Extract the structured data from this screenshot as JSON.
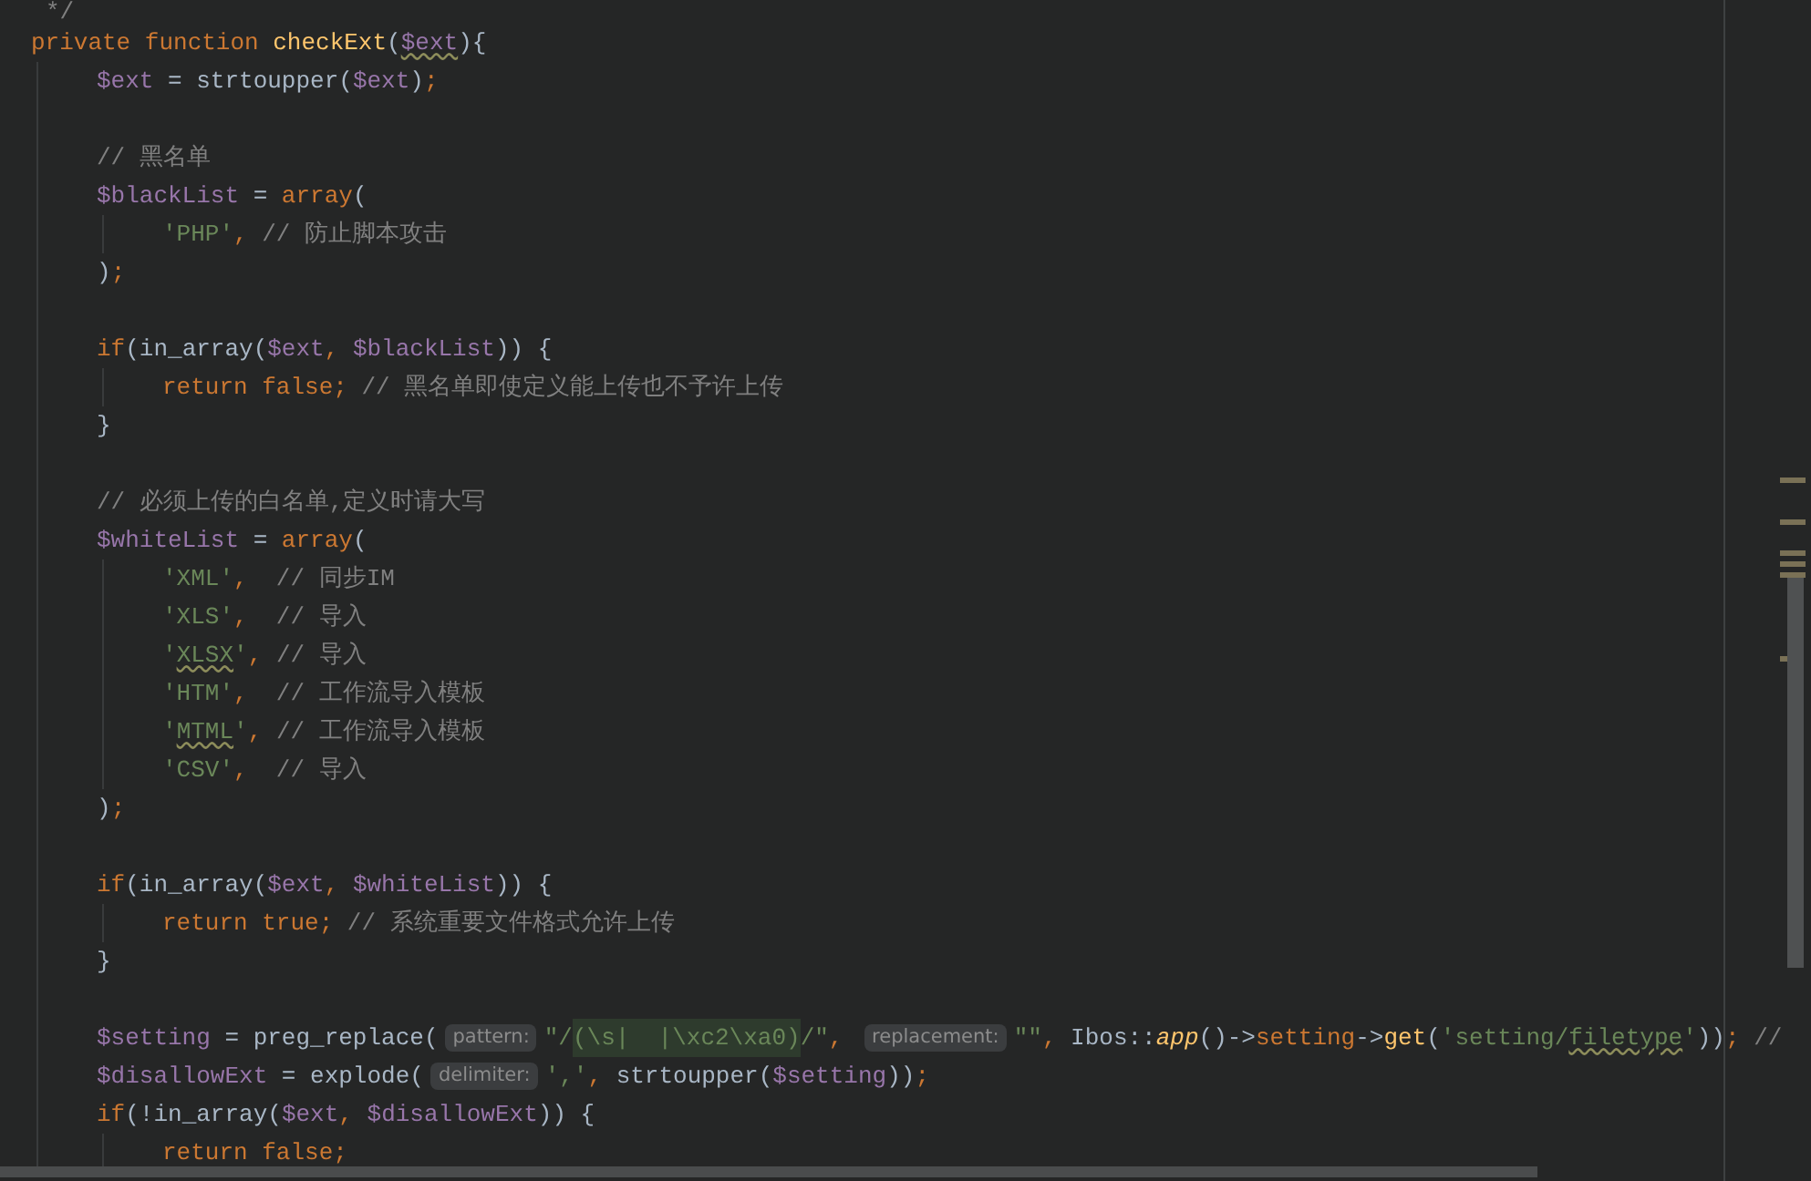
{
  "editor": {
    "lines": [
      {
        "kind": "code",
        "tokens": [
          {
            "kind": "comment",
            "text": "*/"
          }
        ]
      },
      {
        "kind": "code",
        "tokens": [
          {
            "kind": "keyword",
            "text": "private function "
          },
          {
            "kind": "function",
            "text": "checkExt"
          },
          {
            "kind": "plain",
            "text": "("
          },
          {
            "kind": "variable_warn",
            "text": "$ext"
          },
          {
            "kind": "plain",
            "text": "){"
          }
        ],
        "children": [
          {
            "kind": "code",
            "tokens": [
              {
                "kind": "variable",
                "text": "$ext"
              },
              {
                "kind": "plain",
                "text": " = strtoupper("
              },
              {
                "kind": "variable",
                "text": "$ext"
              },
              {
                "kind": "plain",
                "text": ")"
              },
              {
                "kind": "keyword",
                "text": ";"
              }
            ]
          },
          {
            "kind": "blank"
          },
          {
            "kind": "code",
            "tokens": [
              {
                "kind": "comment",
                "text": "// 黑名单"
              }
            ]
          },
          {
            "kind": "code",
            "tokens": [
              {
                "kind": "variable",
                "text": "$blackList"
              },
              {
                "kind": "plain",
                "text": " = "
              },
              {
                "kind": "keyword",
                "text": "array"
              },
              {
                "kind": "plain",
                "text": "("
              }
            ],
            "children": [
              {
                "kind": "code",
                "tokens": [
                  {
                    "kind": "string",
                    "text": "'PHP'"
                  },
                  {
                    "kind": "keyword",
                    "text": ","
                  },
                  {
                    "kind": "comment",
                    "text": " // 防止脚本攻击"
                  }
                ]
              }
            ]
          },
          {
            "kind": "code",
            "tokens": [
              {
                "kind": "plain",
                "text": ")"
              },
              {
                "kind": "keyword",
                "text": ";"
              }
            ]
          },
          {
            "kind": "blank"
          },
          {
            "kind": "code",
            "tokens": [
              {
                "kind": "keyword",
                "text": "if"
              },
              {
                "kind": "plain",
                "text": "(in_array("
              },
              {
                "kind": "variable",
                "text": "$ext"
              },
              {
                "kind": "keyword",
                "text": ", "
              },
              {
                "kind": "variable",
                "text": "$blackList"
              },
              {
                "kind": "plain",
                "text": ")) {"
              }
            ],
            "children": [
              {
                "kind": "code",
                "tokens": [
                  {
                    "kind": "keyword",
                    "text": "return false;"
                  },
                  {
                    "kind": "comment",
                    "text": " // 黑名单即使定义能上传也不予许上传"
                  }
                ]
              }
            ]
          },
          {
            "kind": "code",
            "tokens": [
              {
                "kind": "plain",
                "text": "}"
              }
            ]
          },
          {
            "kind": "blank"
          },
          {
            "kind": "code",
            "tokens": [
              {
                "kind": "comment",
                "text": "// 必须上传的白名单,定义时请大写"
              }
            ]
          },
          {
            "kind": "code",
            "tokens": [
              {
                "kind": "variable",
                "text": "$whiteList"
              },
              {
                "kind": "plain",
                "text": " = "
              },
              {
                "kind": "keyword",
                "text": "array"
              },
              {
                "kind": "plain",
                "text": "("
              }
            ],
            "children": [
              {
                "kind": "code",
                "tokens": [
                  {
                    "kind": "string",
                    "text": "'XML'"
                  },
                  {
                    "kind": "keyword",
                    "text": ",  "
                  },
                  {
                    "kind": "comment",
                    "text": "// 同步IM"
                  }
                ]
              },
              {
                "kind": "code",
                "tokens": [
                  {
                    "kind": "string",
                    "text": "'XLS'"
                  },
                  {
                    "kind": "keyword",
                    "text": ",  "
                  },
                  {
                    "kind": "comment",
                    "text": "// 导入"
                  }
                ]
              },
              {
                "kind": "code",
                "tokens": [
                  {
                    "kind": "string",
                    "text": "'"
                  },
                  {
                    "kind": "string_warn",
                    "text": "XLSX"
                  },
                  {
                    "kind": "string",
                    "text": "'"
                  },
                  {
                    "kind": "keyword",
                    "text": ", "
                  },
                  {
                    "kind": "comment",
                    "text": "// 导入"
                  }
                ]
              },
              {
                "kind": "code",
                "tokens": [
                  {
                    "kind": "string",
                    "text": "'HTM'"
                  },
                  {
                    "kind": "keyword",
                    "text": ",  "
                  },
                  {
                    "kind": "comment",
                    "text": "// 工作流导入模板"
                  }
                ]
              },
              {
                "kind": "code",
                "tokens": [
                  {
                    "kind": "string",
                    "text": "'"
                  },
                  {
                    "kind": "string_warn",
                    "text": "MTML"
                  },
                  {
                    "kind": "string",
                    "text": "'"
                  },
                  {
                    "kind": "keyword",
                    "text": ", "
                  },
                  {
                    "kind": "comment",
                    "text": "// 工作流导入模板"
                  }
                ]
              },
              {
                "kind": "code",
                "tokens": [
                  {
                    "kind": "string",
                    "text": "'CSV'"
                  },
                  {
                    "kind": "keyword",
                    "text": ",  "
                  },
                  {
                    "kind": "comment",
                    "text": "// 导入"
                  }
                ]
              }
            ]
          },
          {
            "kind": "code",
            "tokens": [
              {
                "kind": "plain",
                "text": ")"
              },
              {
                "kind": "keyword",
                "text": ";"
              }
            ]
          },
          {
            "kind": "blank"
          },
          {
            "kind": "code",
            "tokens": [
              {
                "kind": "keyword",
                "text": "if"
              },
              {
                "kind": "plain",
                "text": "(in_array("
              },
              {
                "kind": "variable",
                "text": "$ext"
              },
              {
                "kind": "keyword",
                "text": ", "
              },
              {
                "kind": "variable",
                "text": "$whiteList"
              },
              {
                "kind": "plain",
                "text": ")) {"
              }
            ],
            "children": [
              {
                "kind": "code",
                "tokens": [
                  {
                    "kind": "keyword",
                    "text": "return true;"
                  },
                  {
                    "kind": "comment",
                    "text": " // 系统重要文件格式允许上传"
                  }
                ]
              }
            ]
          },
          {
            "kind": "code",
            "tokens": [
              {
                "kind": "plain",
                "text": "}"
              }
            ]
          },
          {
            "kind": "blank"
          },
          {
            "kind": "code",
            "tokens": [
              {
                "kind": "variable",
                "text": "$setting"
              },
              {
                "kind": "plain",
                "text": " = preg_replace("
              },
              {
                "kind": "hint",
                "text": "pattern:"
              },
              {
                "kind": "string",
                "text": "\"/"
              },
              {
                "kind": "regex",
                "text": "(\\s|  |\\xc2\\xa0)"
              },
              {
                "kind": "string",
                "text": "/\""
              },
              {
                "kind": "keyword",
                "text": ", "
              },
              {
                "kind": "hint",
                "text": "replacement:"
              },
              {
                "kind": "string",
                "text": "\"\""
              },
              {
                "kind": "keyword",
                "text": ", "
              },
              {
                "kind": "plain",
                "text": "Ibos::"
              },
              {
                "kind": "static_call",
                "text": "app"
              },
              {
                "kind": "plain",
                "text": "()->"
              },
              {
                "kind": "keyword",
                "text": "setting"
              },
              {
                "kind": "plain",
                "text": "->"
              },
              {
                "kind": "function",
                "text": "get"
              },
              {
                "kind": "plain",
                "text": "("
              },
              {
                "kind": "string",
                "text": "'setting/"
              },
              {
                "kind": "string_warn",
                "text": "filetype"
              },
              {
                "kind": "string",
                "text": "'"
              },
              {
                "kind": "plain",
                "text": "))"
              },
              {
                "kind": "keyword",
                "text": ";"
              },
              {
                "kind": "comment",
                "text": " //"
              }
            ]
          },
          {
            "kind": "code",
            "tokens": [
              {
                "kind": "variable",
                "text": "$disallowExt"
              },
              {
                "kind": "plain",
                "text": " = explode("
              },
              {
                "kind": "hint",
                "text": "delimiter:"
              },
              {
                "kind": "string",
                "text": "','"
              },
              {
                "kind": "keyword",
                "text": ", "
              },
              {
                "kind": "plain",
                "text": "strtoupper("
              },
              {
                "kind": "variable",
                "text": "$setting"
              },
              {
                "kind": "plain",
                "text": "))"
              },
              {
                "kind": "keyword",
                "text": ";"
              }
            ]
          },
          {
            "kind": "code",
            "tokens": [
              {
                "kind": "keyword",
                "text": "if"
              },
              {
                "kind": "plain",
                "text": "(!in_array("
              },
              {
                "kind": "variable",
                "text": "$ext"
              },
              {
                "kind": "keyword",
                "text": ", "
              },
              {
                "kind": "variable",
                "text": "$disallowExt"
              },
              {
                "kind": "plain",
                "text": ")) {"
              }
            ],
            "children": [
              {
                "kind": "code",
                "tokens": [
                  {
                    "kind": "keyword",
                    "text": "return false;"
                  }
                ]
              }
            ]
          }
        ]
      }
    ]
  }
}
